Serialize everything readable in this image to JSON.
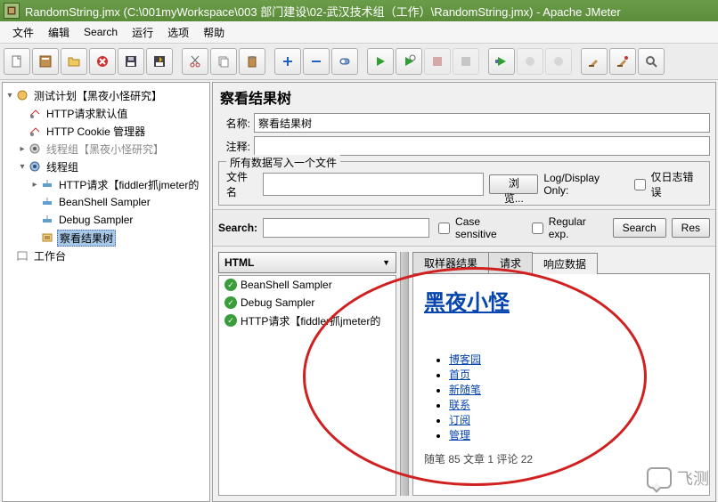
{
  "title": "RandomString.jmx (C:\\001myWorkspace\\003 部门建设\\02-武汉技术组（工作）\\RandomString.jmx) - Apache JMeter",
  "menu": {
    "file": "文件",
    "edit": "编辑",
    "search": "Search",
    "run": "运行",
    "options": "选项",
    "help": "帮助"
  },
  "tree": {
    "root": "测试计划【黑夜小怪研究】",
    "httpdef": "HTTP请求默认值",
    "cookie": "HTTP Cookie 管理器",
    "tg1": "线程组【黑夜小怪研究】",
    "tg2": "线程组",
    "http": "HTTP请求【fiddler抓jmeter的",
    "bsh": "BeanShell Sampler",
    "dbg": "Debug Sampler",
    "viewtree": "察看结果树",
    "workbench": "工作台"
  },
  "panel": {
    "title": "察看结果树",
    "name_label": "名称:",
    "name_value": "察看结果树",
    "comment_label": "注释:",
    "comment_value": "",
    "filegroup": "所有数据写入一个文件",
    "filename_label": "文件名",
    "filename_value": "",
    "browse": "浏览...",
    "logonly": "Log/Display Only:",
    "errorsonly": "仅日志错误"
  },
  "searchbar": {
    "label": "Search:",
    "value": "",
    "case": "Case sensitive",
    "regex": "Regular exp.",
    "search_btn": "Search",
    "reset_btn": "Res"
  },
  "results": {
    "renderer": "HTML",
    "items": [
      "BeanShell Sampler",
      "Debug Sampler",
      "HTTP请求【fiddler抓jmeter的"
    ],
    "tabs": {
      "sampler": "取样器结果",
      "request": "请求",
      "response": "响应数据"
    },
    "page_title": "黑夜小怪",
    "links": [
      "博客园",
      "首页",
      "新随笔",
      "联系",
      "订阅",
      "管理"
    ],
    "footer": "随笔  85 文章  1 评论  22"
  },
  "watermark": "飞测"
}
